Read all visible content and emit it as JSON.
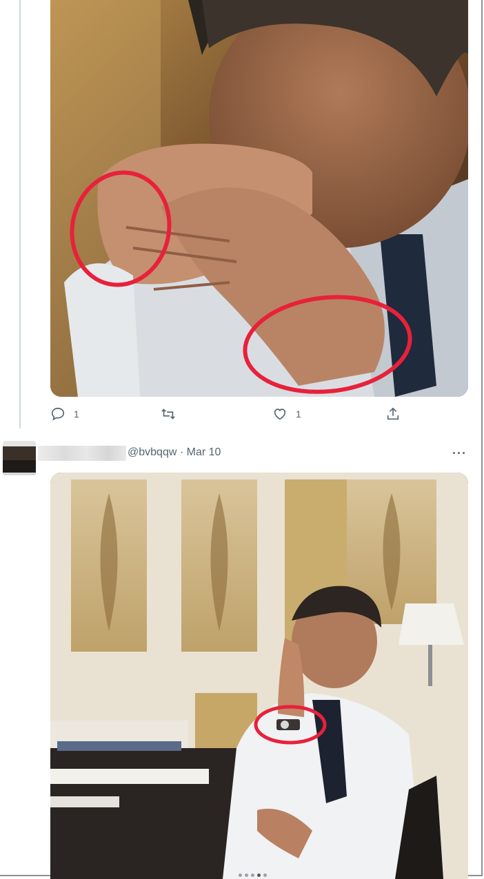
{
  "tweet1": {
    "reply_count": "1",
    "like_count": "1",
    "icons": [
      "reply-icon",
      "retweet-icon",
      "like-icon",
      "share-icon"
    ]
  },
  "tweet2": {
    "handle": "@bvbqqw",
    "separator": "·",
    "date": "Mar 10",
    "more_label": "···"
  },
  "colors": {
    "annotation": "#e8213a",
    "icon_gray": "#536471",
    "thread_line": "#cfd9de"
  },
  "carousel": {
    "count": 5,
    "active": 3
  }
}
